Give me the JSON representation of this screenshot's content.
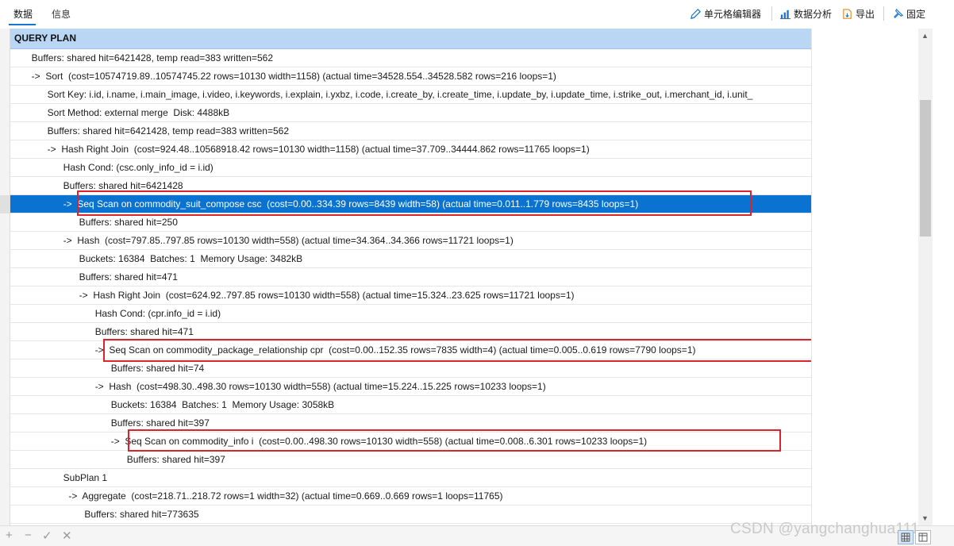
{
  "tabs": [
    {
      "label": "数据",
      "active": true
    },
    {
      "label": "信息",
      "active": false
    }
  ],
  "toolbar": {
    "cell_editor": "单元格编辑器",
    "data_analysis": "数据分析",
    "export": "导出",
    "pin": "固定"
  },
  "grid": {
    "column_header": "QUERY PLAN",
    "selected_row_index": 8,
    "rows": [
      "        Buffers: shared hit=6421428, temp read=383 written=562",
      "        ->  Sort  (cost=10574719.89..10574745.22 rows=10130 width=1158) (actual time=34528.554..34528.582 rows=216 loops=1)",
      "              Sort Key: i.id, i.name, i.main_image, i.video, i.keywords, i.explain, i.yxbz, i.code, i.create_by, i.create_time, i.update_by, i.update_time, i.strike_out, i.merchant_id, i.unit_",
      "              Sort Method: external merge  Disk: 4488kB",
      "              Buffers: shared hit=6421428, temp read=383 written=562",
      "              ->  Hash Right Join  (cost=924.48..10568918.42 rows=10130 width=1158) (actual time=37.709..34444.862 rows=11765 loops=1)",
      "                    Hash Cond: (csc.only_info_id = i.id)",
      "                    Buffers: shared hit=6421428",
      "                    ->  Seq Scan on commodity_suit_compose csc  (cost=0.00..334.39 rows=8439 width=58) (actual time=0.011..1.779 rows=8435 loops=1)",
      "                          Buffers: shared hit=250",
      "                    ->  Hash  (cost=797.85..797.85 rows=10130 width=558) (actual time=34.364..34.366 rows=11721 loops=1)",
      "                          Buckets: 16384  Batches: 1  Memory Usage: 3482kB",
      "                          Buffers: shared hit=471",
      "                          ->  Hash Right Join  (cost=624.92..797.85 rows=10130 width=558) (actual time=15.324..23.625 rows=11721 loops=1)",
      "                                Hash Cond: (cpr.info_id = i.id)",
      "                                Buffers: shared hit=471",
      "                                ->  Seq Scan on commodity_package_relationship cpr  (cost=0.00..152.35 rows=7835 width=4) (actual time=0.005..0.619 rows=7790 loops=1)",
      "                                      Buffers: shared hit=74",
      "                                ->  Hash  (cost=498.30..498.30 rows=10130 width=558) (actual time=15.224..15.225 rows=10233 loops=1)",
      "                                      Buckets: 16384  Batches: 1  Memory Usage: 3058kB",
      "                                      Buffers: shared hit=397",
      "                                      ->  Seq Scan on commodity_info i  (cost=0.00..498.30 rows=10130 width=558) (actual time=0.008..6.301 rows=10233 loops=1)",
      "                                            Buffers: shared hit=397",
      "                    SubPlan 1",
      "                      ->  Aggregate  (cost=218.71..218.72 rows=1 width=32) (actual time=0.669..0.669 rows=1 loops=11765)",
      "                            Buffers: shared hit=773635",
      ""
    ]
  },
  "watermark": "CSDN @yangchanghua111",
  "colors": {
    "selection": "#0a73d1",
    "header": "#b9d6f4",
    "highlight_box": "#d9242b",
    "accent": "#1677d2"
  }
}
